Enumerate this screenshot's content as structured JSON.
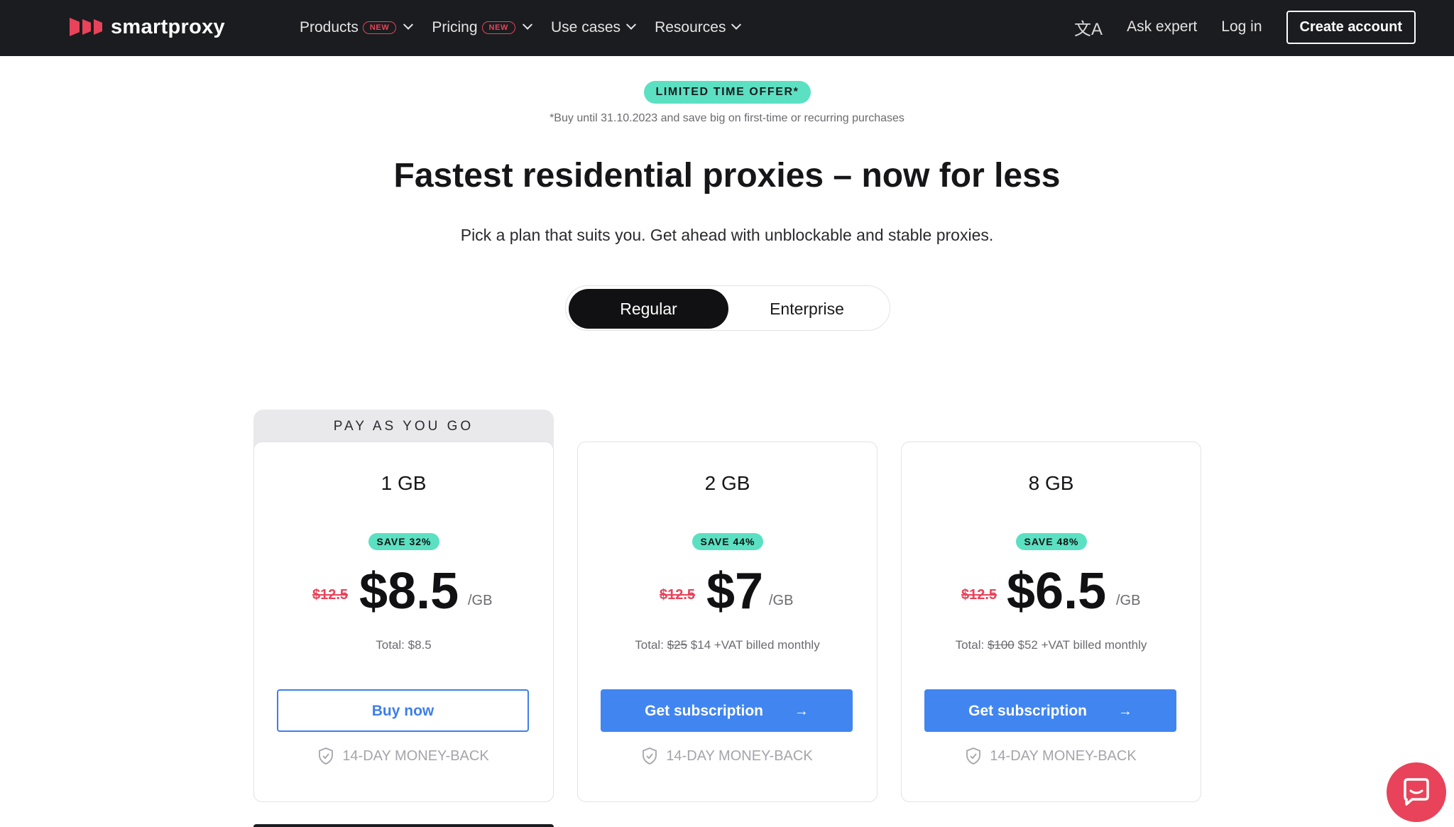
{
  "header": {
    "logo": "smartproxy",
    "nav": [
      {
        "label": "Products",
        "badge": "NEW"
      },
      {
        "label": "Pricing",
        "badge": "NEW"
      },
      {
        "label": "Use cases",
        "badge": ""
      },
      {
        "label": "Resources",
        "badge": ""
      }
    ],
    "ask_expert": "Ask expert",
    "login": "Log in",
    "create_account": "Create account"
  },
  "offer": {
    "pill": "LIMITED TIME OFFER*",
    "note": "*Buy until 31.10.2023 and save big on first-time or recurring purchases"
  },
  "hero": {
    "title": "Fastest residential proxies – now for less",
    "subtitle": "Pick a plan that suits you. Get ahead with unblockable and stable proxies."
  },
  "toggle": {
    "options": [
      "Regular",
      "Enterprise"
    ],
    "selected": "Regular"
  },
  "ribbon": "PAY AS YOU GO",
  "plans": [
    {
      "size": "1 GB",
      "save": "SAVE 32%",
      "old_price": "$12.5",
      "price": "$8.5",
      "unit": "/GB",
      "total_prefix": "Total: $8.5",
      "total_old": "",
      "total_new": "",
      "cta": "Buy now",
      "money_back": "14-DAY MONEY-BACK"
    },
    {
      "size": "2 GB",
      "save": "SAVE 44%",
      "old_price": "$12.5",
      "price": "$7",
      "unit": "/GB",
      "total_prefix": "Total:",
      "total_old": "$25",
      "total_new": "$14 +VAT billed monthly",
      "cta": "Get subscription",
      "money_back": "14-DAY MONEY-BACK"
    },
    {
      "size": "8 GB",
      "save": "SAVE 48%",
      "old_price": "$12.5",
      "price": "$6.5",
      "unit": "/GB",
      "total_prefix": "Total:",
      "total_old": "$100",
      "total_new": "$52 +VAT billed monthly",
      "cta": "Get subscription",
      "money_back": "14-DAY MONEY-BACK"
    }
  ],
  "colors": {
    "brand": "#e8435a",
    "accent": "#4185f0",
    "highlight": "#5be0c2",
    "dark": "#1b1c1f"
  },
  "icons": [
    "translate-icon",
    "chevron-down-icon",
    "arrow-right-icon",
    "shield-check-icon",
    "chat-icon"
  ]
}
